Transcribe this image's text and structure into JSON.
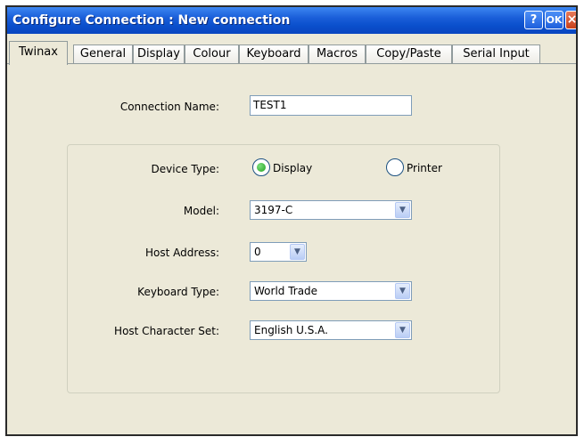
{
  "window": {
    "title": "Configure Connection : New connection",
    "help_label": "?",
    "ok_label": "OK",
    "close_label": "×"
  },
  "tabs": [
    {
      "label": "Twinax",
      "active": true
    },
    {
      "label": "General"
    },
    {
      "label": "Display"
    },
    {
      "label": "Colour"
    },
    {
      "label": "Keyboard"
    },
    {
      "label": "Macros"
    },
    {
      "label": "Copy/Paste"
    },
    {
      "label": "Serial Input"
    }
  ],
  "form": {
    "connection_name_label": "Connection Name:",
    "connection_name_value": "TEST1",
    "device_type_label": "Device Type:",
    "device_options": [
      {
        "label": "Display",
        "selected": true
      },
      {
        "label": "Printer",
        "selected": false
      }
    ],
    "model_label": "Model:",
    "model_value": "3197-C",
    "host_address_label": "Host Address:",
    "host_address_value": "0",
    "keyboard_type_label": "Keyboard Type:",
    "keyboard_type_value": "World Trade",
    "host_charset_label": "Host Character Set:",
    "host_charset_value": "English U.S.A."
  },
  "icons": {
    "dropdown": "chevron-down-icon"
  },
  "colors": {
    "titlebar": "#0a4fcc",
    "dialog_bg": "#ece9d8",
    "radio_selected": "#21a121",
    "input_border": "#7f9db9"
  }
}
